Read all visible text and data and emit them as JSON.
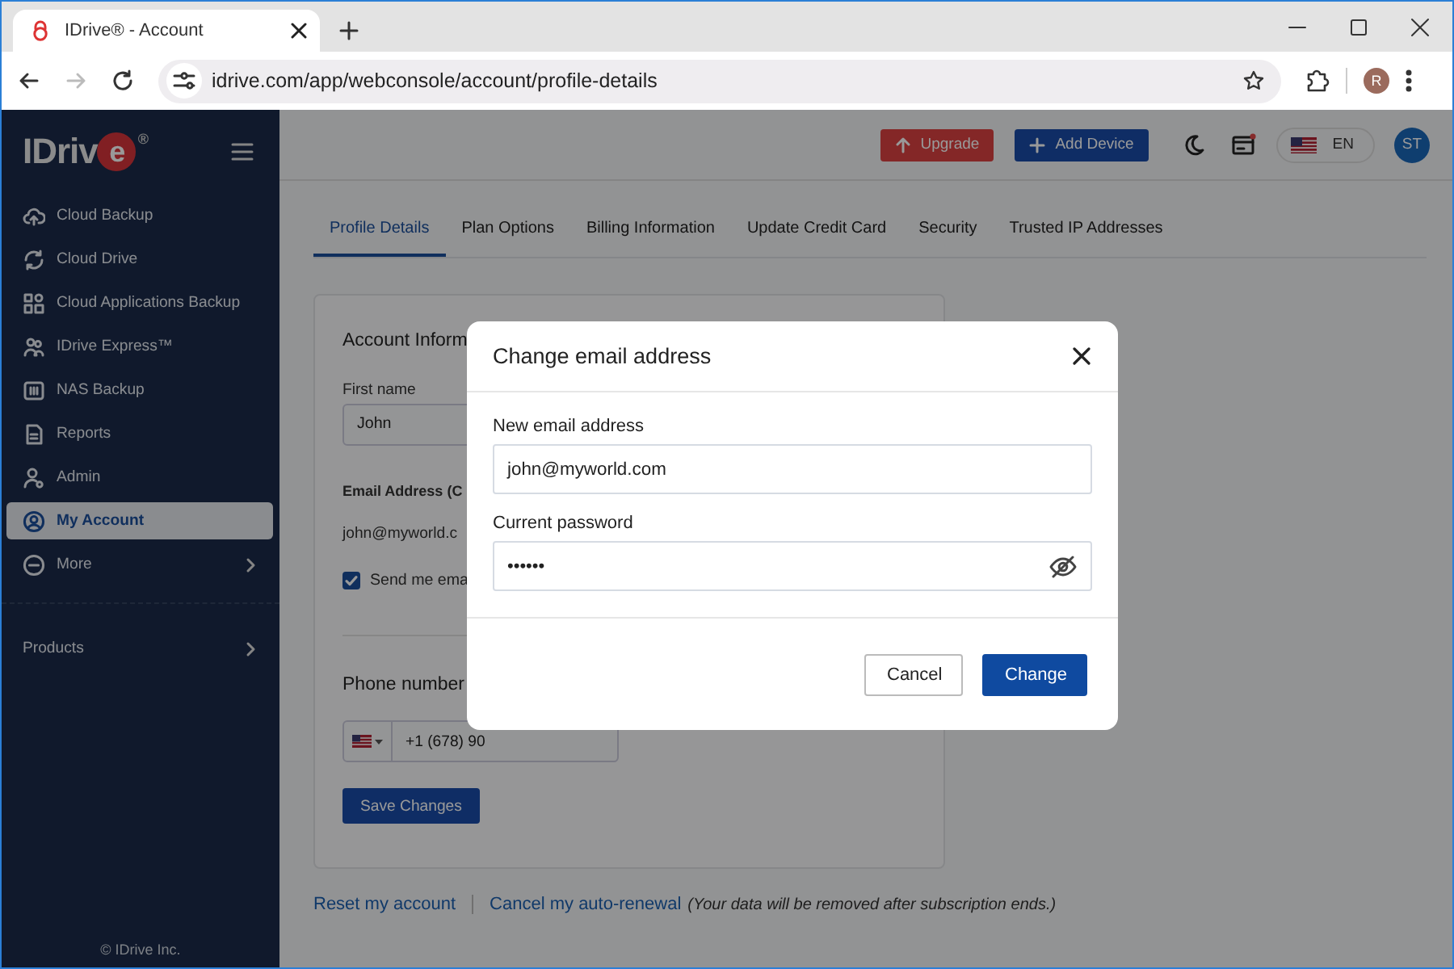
{
  "browser": {
    "tab_title": "IDrive® - Account",
    "url": "idrive.com/app/webconsole/account/profile-details",
    "forward_disabled": true,
    "profile_initial": "R"
  },
  "sidebar": {
    "logo": {
      "text": "IDriv",
      "mark": "e",
      "reg": "®"
    },
    "items": [
      {
        "label": "Cloud Backup",
        "selected": false,
        "submenu": false
      },
      {
        "label": "Cloud Drive",
        "selected": false,
        "submenu": false
      },
      {
        "label": "Cloud Applications Backup",
        "selected": false,
        "submenu": false
      },
      {
        "label": "IDrive Express™",
        "selected": false,
        "submenu": false
      },
      {
        "label": "NAS Backup",
        "selected": false,
        "submenu": false
      },
      {
        "label": "Reports",
        "selected": false,
        "submenu": false
      },
      {
        "label": "Admin",
        "selected": false,
        "submenu": false
      },
      {
        "label": "My Account",
        "selected": true,
        "submenu": false
      },
      {
        "label": "More",
        "selected": false,
        "submenu": true
      }
    ],
    "sections": [
      {
        "label": "Products",
        "submenu": true
      }
    ],
    "footer": "© IDrive Inc."
  },
  "header": {
    "upgrade": "Upgrade",
    "add_device": "Add Device",
    "language": "EN",
    "avatar": "ST",
    "notification": true
  },
  "tabs": [
    {
      "label": "Profile Details",
      "selected": true
    },
    {
      "label": "Plan Options",
      "selected": false
    },
    {
      "label": "Billing Information",
      "selected": false
    },
    {
      "label": "Update Credit Card",
      "selected": false
    },
    {
      "label": "Security",
      "selected": false
    },
    {
      "label": "Trusted IP Addresses",
      "selected": false
    }
  ],
  "card": {
    "heading": "Account Inform",
    "first_name": {
      "label": "First name",
      "value": "John"
    },
    "email": {
      "label": "Email Address (C",
      "value": "john@myworld.c"
    },
    "newsletter": {
      "label": "Send me ema",
      "checked": true
    },
    "phone": {
      "heading": "Phone number",
      "value": "+1 (678) 90"
    },
    "save": "Save Changes"
  },
  "links": [
    {
      "label": "Reset my account"
    },
    {
      "label": "Cancel my auto-renewal"
    }
  ],
  "note": "(Your data will be removed after subscription ends.)",
  "modal": {
    "title": "Change email address",
    "fields": [
      {
        "kind": "email",
        "label": "New email address",
        "value": "john@myworld.com"
      },
      {
        "kind": "password",
        "label": "Current password",
        "value": "••••••"
      }
    ],
    "buttons": [
      {
        "kind": "secondary",
        "label": "Cancel"
      },
      {
        "kind": "primary",
        "label": "Change"
      }
    ]
  }
}
